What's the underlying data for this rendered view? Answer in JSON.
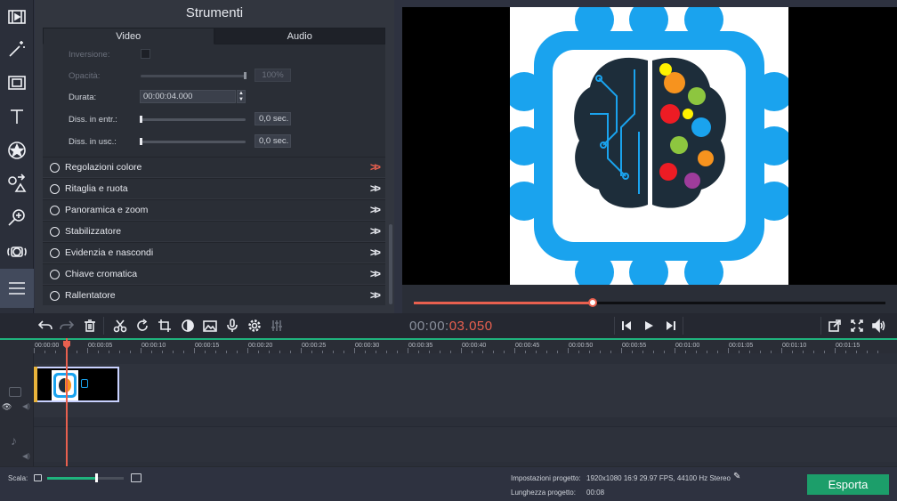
{
  "tools_panel": {
    "title": "Strumenti",
    "tabs": [
      {
        "label": "Video"
      },
      {
        "label": "Audio"
      }
    ],
    "properties": {
      "inversione": {
        "label": "Inversione:"
      },
      "opacita": {
        "label": "Opacità:",
        "value": "100%",
        "level": 1.0
      },
      "durata": {
        "label": "Durata:",
        "value": "00:00:04.000"
      },
      "diss_entr": {
        "label": "Diss. in entr.:",
        "value": "0,0 sec."
      },
      "diss_usc": {
        "label": "Diss. in usc.:",
        "value": "0,0 sec."
      }
    },
    "sections": [
      {
        "label": "Regolazioni colore"
      },
      {
        "label": "Ritaglia e ruota"
      },
      {
        "label": "Panoramica e zoom"
      },
      {
        "label": "Stabilizzatore"
      },
      {
        "label": "Evidenzia e nascondi"
      },
      {
        "label": "Chiave cromatica"
      },
      {
        "label": "Rallentatore"
      }
    ]
  },
  "player": {
    "timecode_prefix": "00:00:",
    "timecode_value": "03.050",
    "progress": 0.38
  },
  "ruler": {
    "ticks": [
      "00:00:00",
      "00:00:05",
      "00:00:10",
      "00:00:15",
      "00:00:20",
      "00:00:25",
      "00:00:30",
      "00:00:35",
      "00:00:40",
      "00:00:45",
      "00:00:50",
      "00:00:55",
      "00:01:00",
      "00:01:05",
      "00:01:10",
      "00:01:15"
    ]
  },
  "status": {
    "scala_label": "Scala:",
    "zoom_level": 0.64,
    "impostazioni_label": "Impostazioni progetto:",
    "impostazioni_value": "1920x1080 16:9 29.97 FPS, 44100 Hz Stereo",
    "lunghezza_label": "Lunghezza progetto:",
    "lunghezza_value": "00:08",
    "export_label": "Esporta"
  },
  "colors": {
    "accent": "#e8604f",
    "green": "#1fb37d",
    "export": "#1c9e6a",
    "logo_blue": "#1aa3ee"
  }
}
